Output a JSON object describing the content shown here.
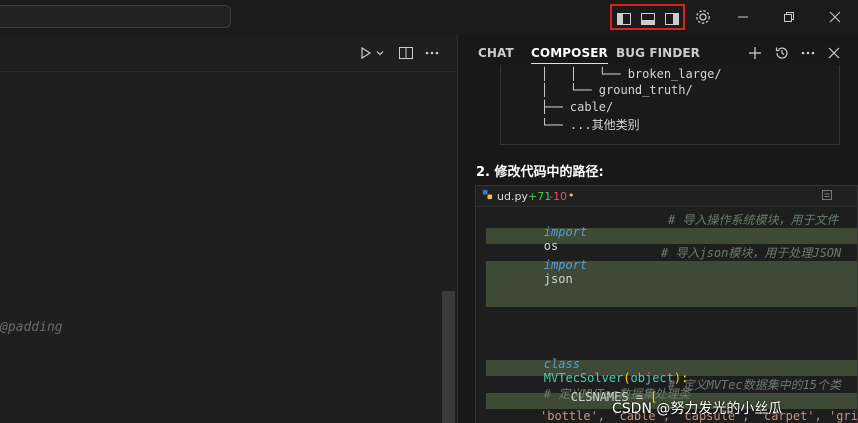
{
  "titlebar": {
    "icons": [
      "layout-sidebar-left-icon",
      "layout-panel-icon",
      "layout-sidebar-right-icon",
      "gear-icon",
      "minimize-icon",
      "restore-icon",
      "close-icon"
    ]
  },
  "editor": {
    "snippet": "@padding",
    "icons": [
      "run-icon",
      "chevron-down-icon",
      "split-editor-icon",
      "more-icon"
    ]
  },
  "panel": {
    "tabs": [
      {
        "label": "CHAT",
        "active": false
      },
      {
        "label": "COMPOSER",
        "active": true
      },
      {
        "label": "BUG FINDER",
        "active": false
      }
    ],
    "icons": [
      "plus-icon",
      "history-icon",
      "more-icon",
      "close-icon"
    ],
    "tree": {
      "lines": [
        "│   │   └── broken_large/",
        "│   └── ground_truth/",
        "├── cable/",
        "└── ...其他类别"
      ]
    },
    "step_label": "2. 修改代码中的路径:",
    "code": {
      "filename": "ud.py",
      "additions": "+71",
      "deletions": "-10",
      "dot": "•",
      "line1_kw": "import",
      "line1_mod": "os",
      "line1_cmt": "# 导入操作系统模块，用于文件",
      "line2_kw": "import",
      "line2_mod": "json",
      "line2_cmt": "# 导入json模块，用于处理JSON",
      "line3_kw": "class",
      "line3_cls": "MVTecSolver",
      "line3_paren_open": "(",
      "line3_base": "object",
      "line3_paren_close": "):",
      "line3_cmt": "# 定义MVTec数据集处理类",
      "line4_var": "CLSNAMES = ",
      "line4_bracket": "[",
      "line4_cmt": "# 定义MVTec数据集中的15个类",
      "line5_strs": "'bottle', 'cable', 'capsule', 'carpet', 'grid'"
    }
  },
  "watermark": "CSDN @努力发光的小丝瓜",
  "colors": {
    "highlight_red": "#e02020",
    "diff_add": "#4ec94e",
    "diff_del": "#f14c4c",
    "added_line_bg": "#3e4a35"
  }
}
